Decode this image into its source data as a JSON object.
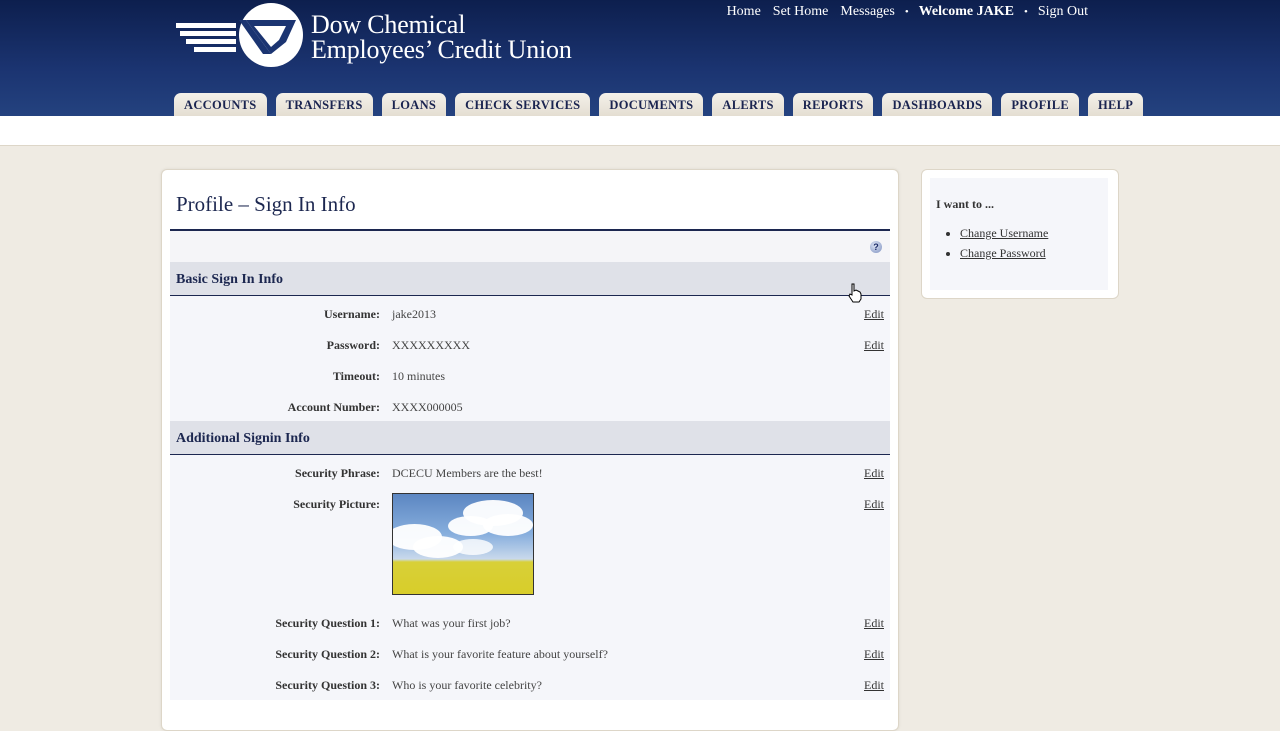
{
  "header": {
    "brand_line1": "Dow Chemical",
    "brand_line2": "Employees’ Credit Union",
    "links": {
      "home": "Home",
      "set_home": "Set Home",
      "messages": "Messages",
      "dot": "•",
      "welcome": "Welcome JAKE",
      "sign_out": "Sign Out"
    },
    "tabs": [
      "ACCOUNTS",
      "TRANSFERS",
      "LOANS",
      "CHECK SERVICES",
      "DOCUMENTS",
      "ALERTS",
      "REPORTS",
      "DASHBOARDS",
      "PROFILE",
      "HELP"
    ]
  },
  "main": {
    "title": "Profile – Sign In Info",
    "help_glyph": "?",
    "basic_section": "Basic Sign In Info",
    "additional_section": "Additional Signin Info",
    "edit_label": "Edit",
    "basic_rows": [
      {
        "label": "Username:",
        "value": "jake2013",
        "editable": true
      },
      {
        "label": "Password:",
        "value": "XXXXXXXXX",
        "editable": true
      },
      {
        "label": "Timeout:",
        "value": "10 minutes",
        "editable": false
      },
      {
        "label": "Account Number:",
        "value": "XXXX000005",
        "editable": false
      }
    ],
    "security_phrase_label": "Security Phrase:",
    "security_phrase_value": "DCECU Members are the best!",
    "security_picture_label": "Security Picture:",
    "questions": [
      {
        "label": "Security Question 1:",
        "value": "What was your first job?"
      },
      {
        "label": "Security Question 2:",
        "value": "What is your favorite feature about yourself?"
      },
      {
        "label": "Security Question 3:",
        "value": "Who is your favorite celebrity?"
      }
    ]
  },
  "sidebar": {
    "title": "I want to ...",
    "links": [
      "Change Username",
      "Change Password"
    ]
  },
  "colors": {
    "header_navy": "#1b3471",
    "title_navy": "#1c2750",
    "section_bg": "#dfe1e8",
    "page_bg": "#efebe3"
  }
}
